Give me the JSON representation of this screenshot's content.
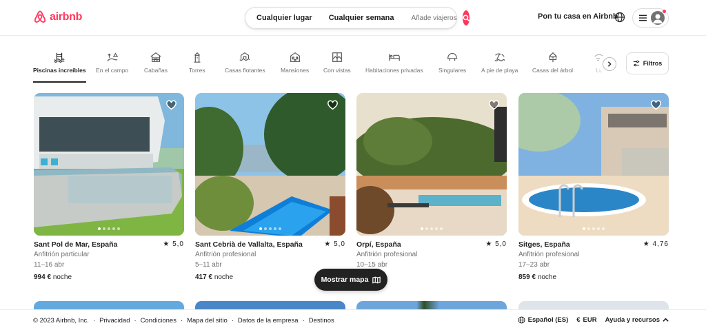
{
  "header": {
    "logo_text": "airbnb",
    "search": {
      "location": "Cualquier lugar",
      "week": "Cualquier semana",
      "guests": "Añade viajeros"
    },
    "host_link": "Pon tu casa en Airbnb"
  },
  "categories": [
    {
      "label": "Piscinas increíbles",
      "icon": "pool-icon",
      "active": true
    },
    {
      "label": "En el campo",
      "icon": "countryside-icon"
    },
    {
      "label": "Cabañas",
      "icon": "cabin-icon"
    },
    {
      "label": "Torres",
      "icon": "tower-icon"
    },
    {
      "label": "Casas flotantes",
      "icon": "houseboat-icon"
    },
    {
      "label": "Mansiones",
      "icon": "mansion-icon"
    },
    {
      "label": "Con vistas",
      "icon": "views-icon"
    },
    {
      "label": "Habitaciones privadas",
      "icon": "bed-icon"
    },
    {
      "label": "Singulares",
      "icon": "unique-icon"
    },
    {
      "label": "A pie de playa",
      "icon": "beach-icon"
    },
    {
      "label": "Casas del árbol",
      "icon": "treehouse-icon"
    },
    {
      "label": "Lu",
      "icon": "lux-icon"
    }
  ],
  "filters_label": "Filtros",
  "listings": [
    {
      "title": "Sant Pol de Mar, España",
      "rating": "5,0",
      "host": "Anfitrión particular",
      "dates": "11–16 abr",
      "price": "994 €",
      "price_unit": "noche"
    },
    {
      "title": "Sant Cebrià de Vallalta, España",
      "rating": "5,0",
      "host": "Anfitrión profesional",
      "dates": "5–11 abr",
      "price": "417 €",
      "price_unit": "noche"
    },
    {
      "title": "Orpí, España",
      "rating": "5,0",
      "host": "Anfitrión profesional",
      "dates": "10–15 abr",
      "price": "",
      "price_unit": "che"
    },
    {
      "title": "Sitges, España",
      "rating": "4,76",
      "host": "Anfitrión profesional",
      "dates": "17–23 abr",
      "price": "859 €",
      "price_unit": "noche"
    }
  ],
  "map_button": "Mostrar mapa",
  "footer": {
    "links": [
      "© 2023 Airbnb, Inc.",
      "·",
      "Privacidad",
      "·",
      "Condiciones",
      "·",
      "Mapa del sitio",
      "·",
      "Datos de la empresa",
      "·",
      "Destinos"
    ],
    "language": "Español (ES)",
    "currency_symbol": "€",
    "currency": "EUR",
    "help": "Ayuda y recursos"
  },
  "colors": {
    "brand": "#ff385c",
    "text": "#222222",
    "muted": "#717171"
  }
}
